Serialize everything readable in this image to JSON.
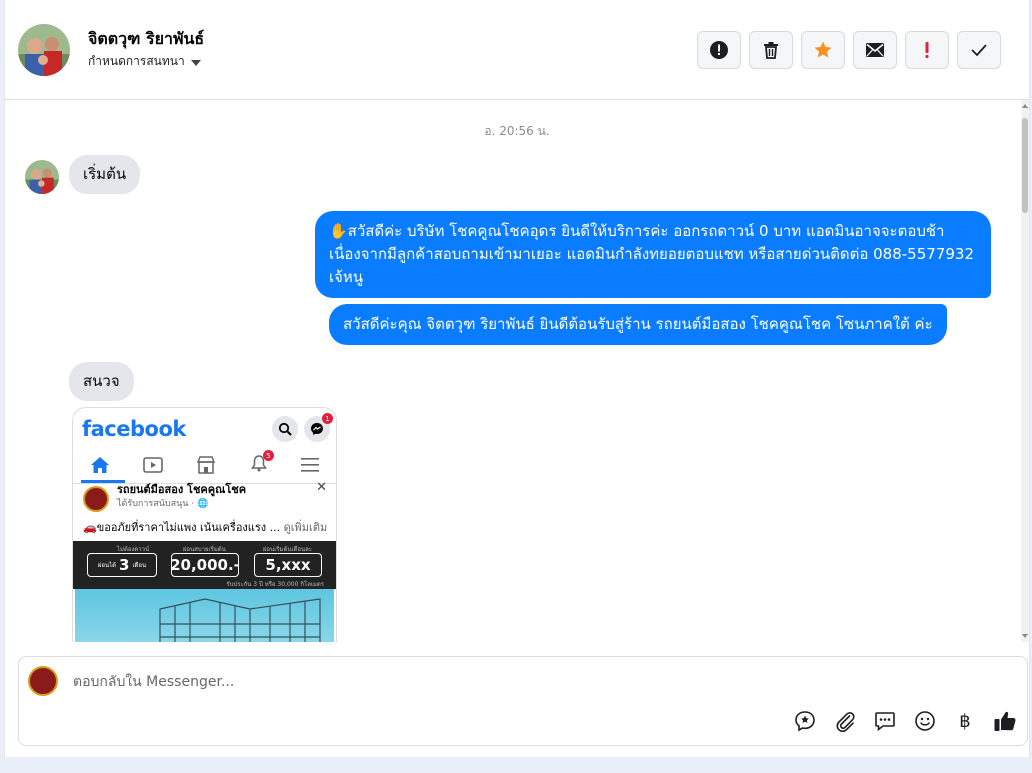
{
  "header": {
    "contact_name": "จิตตวุฑ ริยาพันธ์",
    "settings_label": "กำหนดการสนทนา",
    "actions": [
      "report",
      "delete",
      "star",
      "mark-unread",
      "important",
      "done"
    ]
  },
  "conversation": {
    "timestamp": "อ. 20:56 น.",
    "messages": [
      {
        "from": "contact",
        "text": "เริ่มต้น"
      },
      {
        "from": "page",
        "text": "✋สวัสดีค่ะ บริษัท โชคคูณโชคอุดร ยินดีให้บริการค่ะ ออกรถดาวน์ 0 บาท แอดมินอาจจะตอบช้าเนื่องจากมีลูกค้าสอบถามเข้ามาเยอะ แอดมินกำลังทยอยตอบแชท หรือสายด่วนติดต่อ 088-5577932 เจ้หนู"
      },
      {
        "from": "page",
        "text": "สวัสดีค่ะคุณ จิตตวุฑ ริยาพันธ์ ยินดีต้อนรับสู่ร้าน รถยนต์มือสอง โชคคูณโชค โซนภาคใต้ ค่ะ"
      },
      {
        "from": "contact",
        "text": "สนวจ"
      }
    ],
    "attachment": {
      "app_logo": "facebook",
      "messenger_badge": "1",
      "notification_badge": "5",
      "post_name": "รถยนต์มือสอง โชคคูณโชค",
      "post_sub": "ได้รับการสนับสนุน · 🌐",
      "post_text": "🚗ขออภัยที่ราคาไม่แพง เน้นเครื่องแรง ...",
      "see_more": "ดูเพิ่มเติม",
      "banner": {
        "box1_caption": "ไม่ต้องดาวน์",
        "box1_prefix": "ผ่อนได้",
        "box1_value": "3",
        "box1_unit": "เดือน",
        "box2_caption": "ผ่อนสบายเริ่มต้น",
        "box2_value": "20,000.-",
        "box3_caption": "ผ่อนเริ่มต้นเดือนละ",
        "box3_value": "5,xxx",
        "note": "รับประกัน 3 ปี หรือ 30,000 กิโลเมตร"
      }
    }
  },
  "composer": {
    "placeholder": "ตอบกลับใน Messenger...",
    "tools": [
      "saved-replies",
      "attach",
      "messages",
      "emoji",
      "payment",
      "like"
    ],
    "baht_symbol": "฿"
  },
  "colors": {
    "outgoing_bubble": "#0a7cff",
    "incoming_bubble": "#e4e6eb",
    "star": "#f7931e",
    "important": "#e41e3f"
  }
}
